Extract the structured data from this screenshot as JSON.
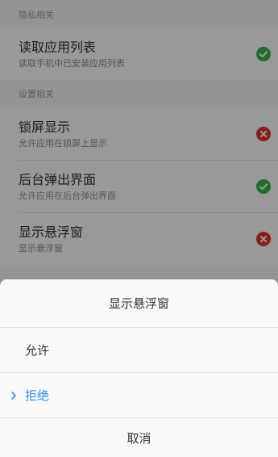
{
  "sections": [
    {
      "header": "隐私相关",
      "items": [
        {
          "title": "读取应用列表",
          "subtitle": "读取手机中已安装应用列表",
          "status": "check-icon"
        }
      ]
    },
    {
      "header": "设置相关",
      "items": [
        {
          "title": "锁屏显示",
          "subtitle": "允许应用在锁屏上显示",
          "status": "cross-icon"
        },
        {
          "title": "后台弹出界面",
          "subtitle": "允许应用在后台弹出界面",
          "status": "check-icon"
        },
        {
          "title": "显示悬浮窗",
          "subtitle": "显示悬浮窗",
          "status": "cross-icon"
        }
      ]
    }
  ],
  "sheet": {
    "title": "显示悬浮窗",
    "options": [
      {
        "label": "允许",
        "selected": false
      },
      {
        "label": "拒绝",
        "selected": true
      }
    ],
    "cancel_label": "取消"
  },
  "colors": {
    "check": "#3bb54a",
    "cross": "#e0342b",
    "selected_accent": "#2b8ff0"
  }
}
